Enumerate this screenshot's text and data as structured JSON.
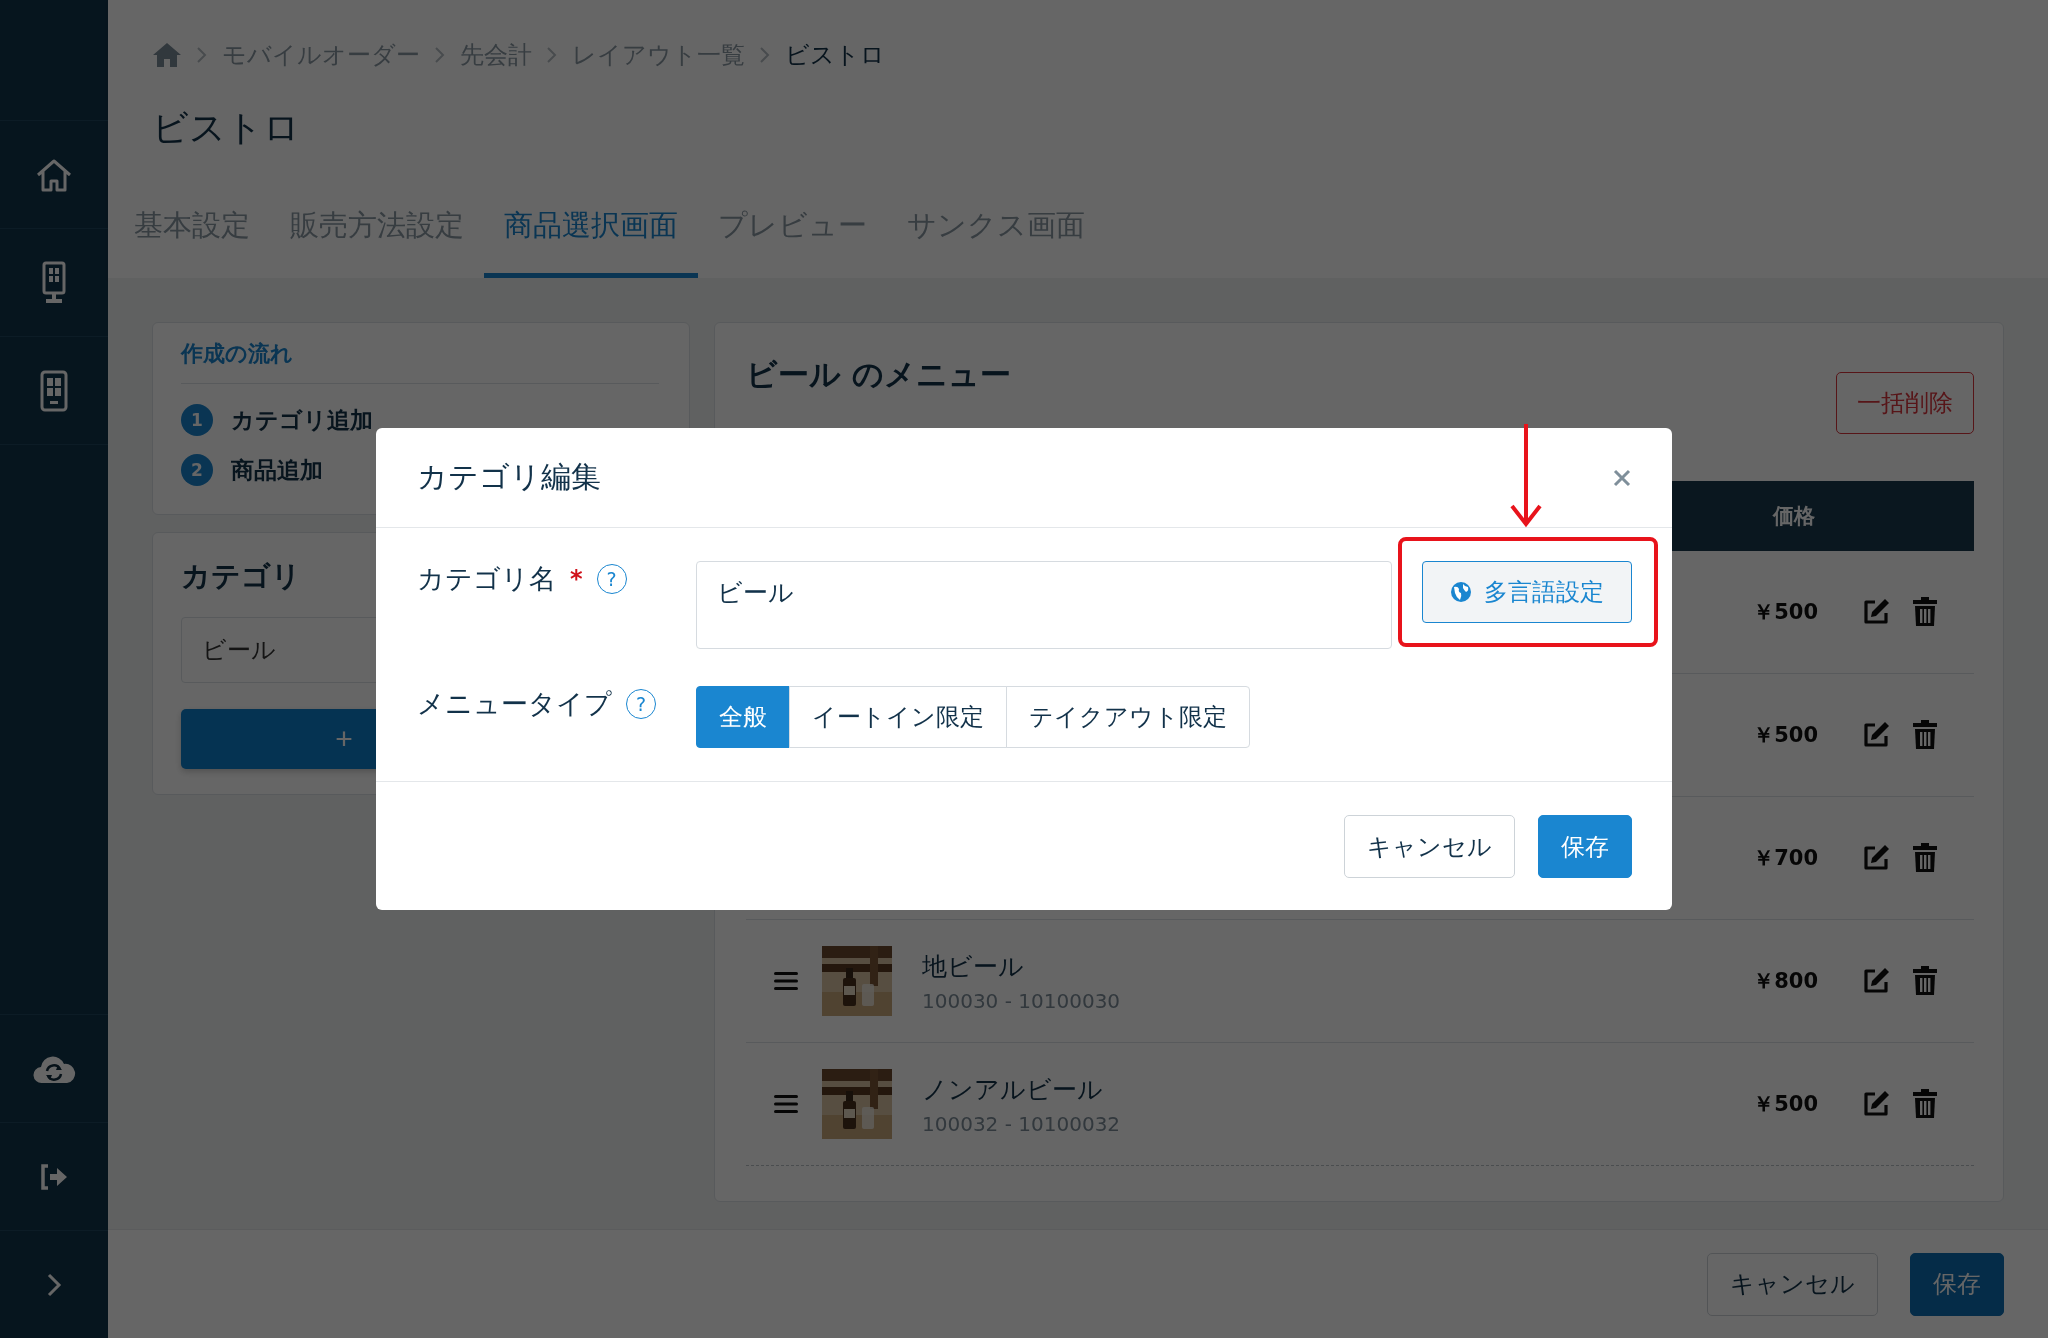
{
  "breadcrumb": [
    {
      "label": "モバイルオーダー",
      "current": false
    },
    {
      "label": "先会計",
      "current": false
    },
    {
      "label": "レイアウト一覧",
      "current": false
    },
    {
      "label": "ビストロ",
      "current": true
    }
  ],
  "page_title": "ビストロ",
  "tabs": [
    {
      "label": "基本設定",
      "selected": false
    },
    {
      "label": "販売方法設定",
      "selected": false
    },
    {
      "label": "商品選択画面",
      "selected": true
    },
    {
      "label": "プレビュー",
      "selected": false
    },
    {
      "label": "サンクス画面",
      "selected": false
    }
  ],
  "flow": {
    "title": "作成の流れ",
    "steps": [
      {
        "number": "1",
        "label": "カテゴリ追加"
      },
      {
        "number": "2",
        "label": "商品追加"
      }
    ]
  },
  "categories": {
    "title": "カテゴリ",
    "items": [
      {
        "label": "ビール"
      }
    ],
    "add_button": "+"
  },
  "menu_panel": {
    "title": "ビール のメニュー",
    "bulk_delete": "一括削除",
    "columns": [
      "価格"
    ],
    "rows": [
      {
        "price": "￥500"
      },
      {
        "price": "￥500"
      },
      {
        "price": "￥700"
      },
      {
        "name": "地ビール",
        "code": "100030 - 10100030",
        "price": "￥800"
      },
      {
        "name": "ノンアルビール",
        "code": "100032 - 10100032",
        "price": "￥500"
      }
    ]
  },
  "footer": {
    "cancel": "キャンセル",
    "save": "保存"
  },
  "modal": {
    "title": "カテゴリ編集",
    "fields": [
      {
        "kind": "text",
        "label": "カテゴリ名",
        "required_mark": "*",
        "help": "?",
        "value": "ビール",
        "extra_button": "多言語設定"
      },
      {
        "kind": "segmented",
        "label": "メニュータイプ",
        "help": "?",
        "options": [
          {
            "label": "全般",
            "selected": true
          },
          {
            "label": "イートイン限定",
            "selected": false
          },
          {
            "label": "テイクアウト限定",
            "selected": false
          }
        ]
      }
    ],
    "cancel": "キャンセル",
    "save": "保存"
  }
}
